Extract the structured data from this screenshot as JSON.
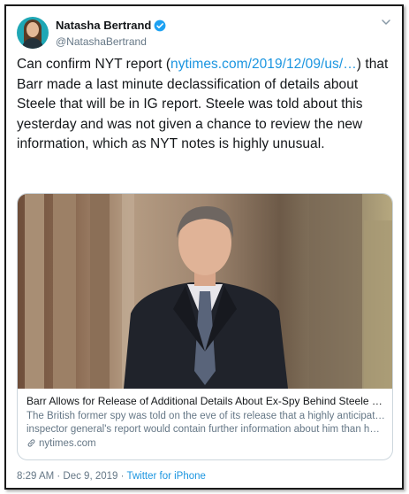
{
  "author": {
    "display_name": "Natasha Bertrand",
    "handle": "@NatashaBertrand",
    "verified": true
  },
  "tweet": {
    "text_before": "Can confirm NYT report (",
    "link_text": "nytimes.com/2019/12/09/us/…",
    "text_after": ") that Barr made a last minute declassification of details about Steele that will be in IG report. Steele was told about this yesterday and was not given a chance to review the new information, which as NYT notes is highly unusual."
  },
  "card": {
    "title": "Barr Allows for Release of Additional Details About Ex-Spy Behind Steele Dossier",
    "description_line1": "The British former spy was told on the eve of its release that a highly anticipated",
    "description_line2": "inspector general's report would contain further information about him than he ...",
    "domain": "nytimes.com"
  },
  "meta": {
    "timestamp": "8:29 AM · Dec 9, 2019",
    "separator": " · ",
    "source": "Twitter for iPhone"
  },
  "icons": {
    "verified": "verified-badge-icon",
    "caret": "chevron-down-icon",
    "link": "link-icon"
  },
  "colors": {
    "link": "#1b95e0",
    "secondary_text": "#657786",
    "border": "#ccd6dd"
  }
}
